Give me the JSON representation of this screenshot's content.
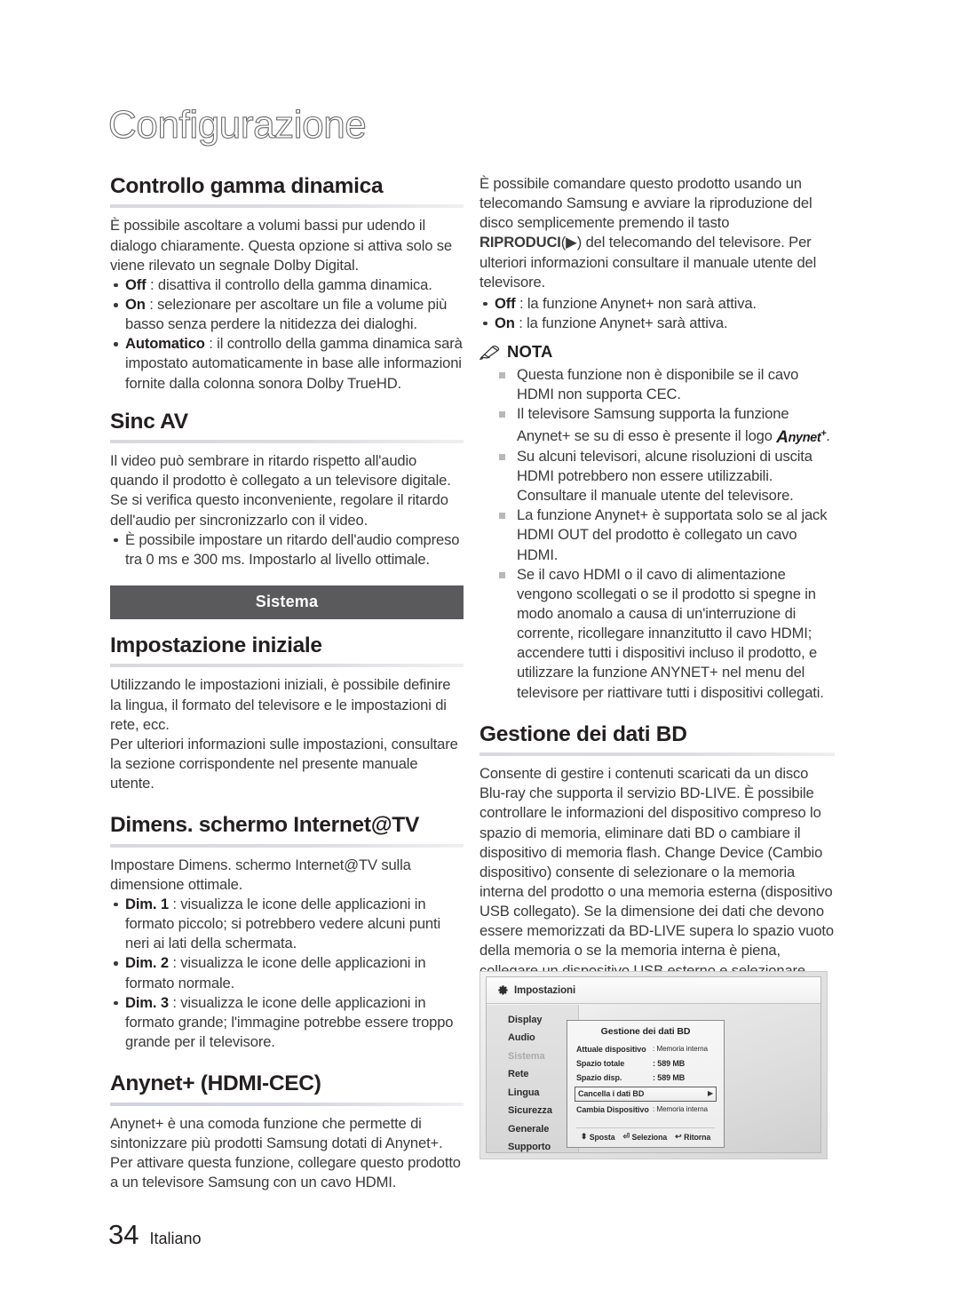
{
  "chapter": {
    "title": "Configurazione"
  },
  "left": {
    "dynamic_range": {
      "heading": "Controllo gamma dinamica",
      "intro": "È possibile ascoltare a volumi bassi pur udendo il dialogo chiaramente. Questa opzione si attiva solo se viene rilevato un segnale Dolby Digital.",
      "options": [
        {
          "term": "Off",
          "text": " : disattiva il controllo della gamma dinamica."
        },
        {
          "term": "On",
          "text": " : selezionare per ascoltare un file a volume più basso senza perdere la nitidezza dei dialoghi."
        },
        {
          "term": "Automatico",
          "text": " : il controllo della gamma dinamica sarà impostato automaticamente in base alle informazioni fornite dalla colonna sonora Dolby TrueHD."
        }
      ]
    },
    "av_sync": {
      "heading": "Sinc AV",
      "intro": "Il video può sembrare in ritardo rispetto all'audio quando il prodotto è collegato a un televisore digitale. Se si verifica questo inconveniente, regolare il ritardo dell'audio per sincronizzarlo con il video.",
      "options": [
        {
          "term": "",
          "text": "È possibile impostare un ritardo dell'audio compreso tra 0 ms e 300 ms. Impostarlo al livello ottimale."
        }
      ]
    },
    "banner": "Sistema",
    "initial_setup": {
      "heading": "Impostazione iniziale",
      "para1": "Utilizzando le impostazioni iniziali, è possibile definire la lingua, il formato del televisore e le impostazioni di rete, ecc.",
      "para2": "Per ulteriori informazioni sulle impostazioni, consultare la sezione corrispondente nel presente manuale utente."
    },
    "screen_size": {
      "heading": "Dimens. schermo Internet@TV",
      "intro": "Impostare Dimens. schermo Internet@TV sulla dimensione ottimale.",
      "options": [
        {
          "term": "Dim. 1",
          "text": " : visualizza le icone delle applicazioni in formato piccolo; si potrebbero vedere alcuni punti neri ai lati della schermata."
        },
        {
          "term": "Dim. 2",
          "text": " : visualizza le icone delle applicazioni in formato normale."
        },
        {
          "term": "Dim. 3",
          "text": " : visualizza le icone delle applicazioni in formato grande; l'immagine potrebbe essere troppo grande per il televisore."
        }
      ]
    },
    "anynet": {
      "heading": "Anynet+ (HDMI-CEC)",
      "intro": "Anynet+ è una comoda funzione che permette di sintonizzare più prodotti Samsung dotati di Anynet+. Per attivare questa funzione, collegare questo prodotto a un televisore Samsung con un cavo HDMI."
    }
  },
  "right": {
    "anynet_cont": {
      "part1": "È possibile comandare questo prodotto usando un telecomando Samsung e avviare la riproduzione del disco semplicemente premendo il tasto ",
      "riproduci": "RIPRODUCI",
      "play_glyph": "(▶)",
      "part2": " del telecomando del televisore. Per ulteriori informazioni consultare il manuale utente del televisore.",
      "options": [
        {
          "term": "Off",
          "text": " : la funzione Anynet+ non sarà attiva."
        },
        {
          "term": "On",
          "text": " : la funzione Anynet+ sarà attiva."
        }
      ]
    },
    "nota": {
      "label": "NOTA",
      "items": [
        {
          "pre": "Questa funzione non è disponibile se il cavo HDMI non supporta CEC.",
          "logo": false,
          "post": ""
        },
        {
          "pre": "Il televisore Samsung supporta la funzione Anynet+ se su di esso è presente il logo ",
          "logo": true,
          "post": "."
        },
        {
          "pre": "Su alcuni televisori, alcune risoluzioni di uscita HDMI potrebbero non essere utilizzabili. Consultare il manuale utente del televisore.",
          "logo": false,
          "post": ""
        },
        {
          "pre": "La funzione Anynet+ è supportata solo se al jack HDMI OUT del prodotto è collegato un cavo HDMI.",
          "logo": false,
          "post": ""
        },
        {
          "pre": "Se il cavo HDMI o il cavo di alimentazione vengono scollegati o se il prodotto si spegne in modo anomalo a causa di un'interruzione di corrente, ricollegare innanzitutto il cavo HDMI; accendere tutti i dispositivi incluso il prodotto, e utilizzare la funzione ANYNET+ nel menu del televisore per riattivare tutti i dispositivi collegati.",
          "logo": false,
          "post": ""
        }
      ],
      "logo_text": {
        "a": "A",
        "name": "nynet",
        "plus": "+"
      }
    },
    "bd_data": {
      "heading": "Gestione dei dati BD",
      "intro": "Consente di gestire i contenuti scaricati da un disco Blu-ray che supporta il servizio BD-LIVE. È possibile controllare le informazioni del dispositivo compreso lo spazio di memoria, eliminare dati BD o cambiare il dispositivo di memoria flash. Change Device (Cambio dispositivo) consente di selezionare o la memoria interna del prodotto o una memoria esterna (dispositivo USB collegato). Se la dimensione dei dati che devono essere memorizzati da BD-LIVE supera lo spazio vuoto della memoria o se la memoria interna è piena, collegare un dispositivo USB esterno e selezionare External Device (Dispositivo esterno) nel menu."
    }
  },
  "tv_screenshot": {
    "titlebar": "Impostazioni",
    "menu_items": [
      {
        "label": "Display",
        "selected": false
      },
      {
        "label": "Audio",
        "selected": false
      },
      {
        "label": "Sistema",
        "selected": true
      },
      {
        "label": "Rete",
        "selected": false
      },
      {
        "label": "Lingua",
        "selected": false
      },
      {
        "label": "Sicurezza",
        "selected": false
      },
      {
        "label": "Generale",
        "selected": false
      },
      {
        "label": "Supporto",
        "selected": false
      }
    ],
    "dialog": {
      "title": "Gestione dei dati BD",
      "rows": [
        {
          "key": "Attuale dispositivo",
          "value": ": Memoria interna",
          "small": true
        },
        {
          "key": "Spazio totale",
          "value": ": 589 MB",
          "small": false
        },
        {
          "key": "Spazio disp.",
          "value": ": 589 MB",
          "small": false
        }
      ],
      "selected_row": {
        "key": "Cancella i dati BD",
        "arrow": "▶"
      },
      "last_row": {
        "key": "Cambia Dispositivo",
        "value": ": Memoria interna"
      },
      "footer": [
        {
          "glyph": "⬍",
          "label": "Sposta"
        },
        {
          "glyph": "⏎",
          "label": "Seleziona"
        },
        {
          "glyph": "↩",
          "label": "Ritorna"
        }
      ]
    }
  },
  "footer": {
    "page_number": "34",
    "language": "Italiano"
  }
}
